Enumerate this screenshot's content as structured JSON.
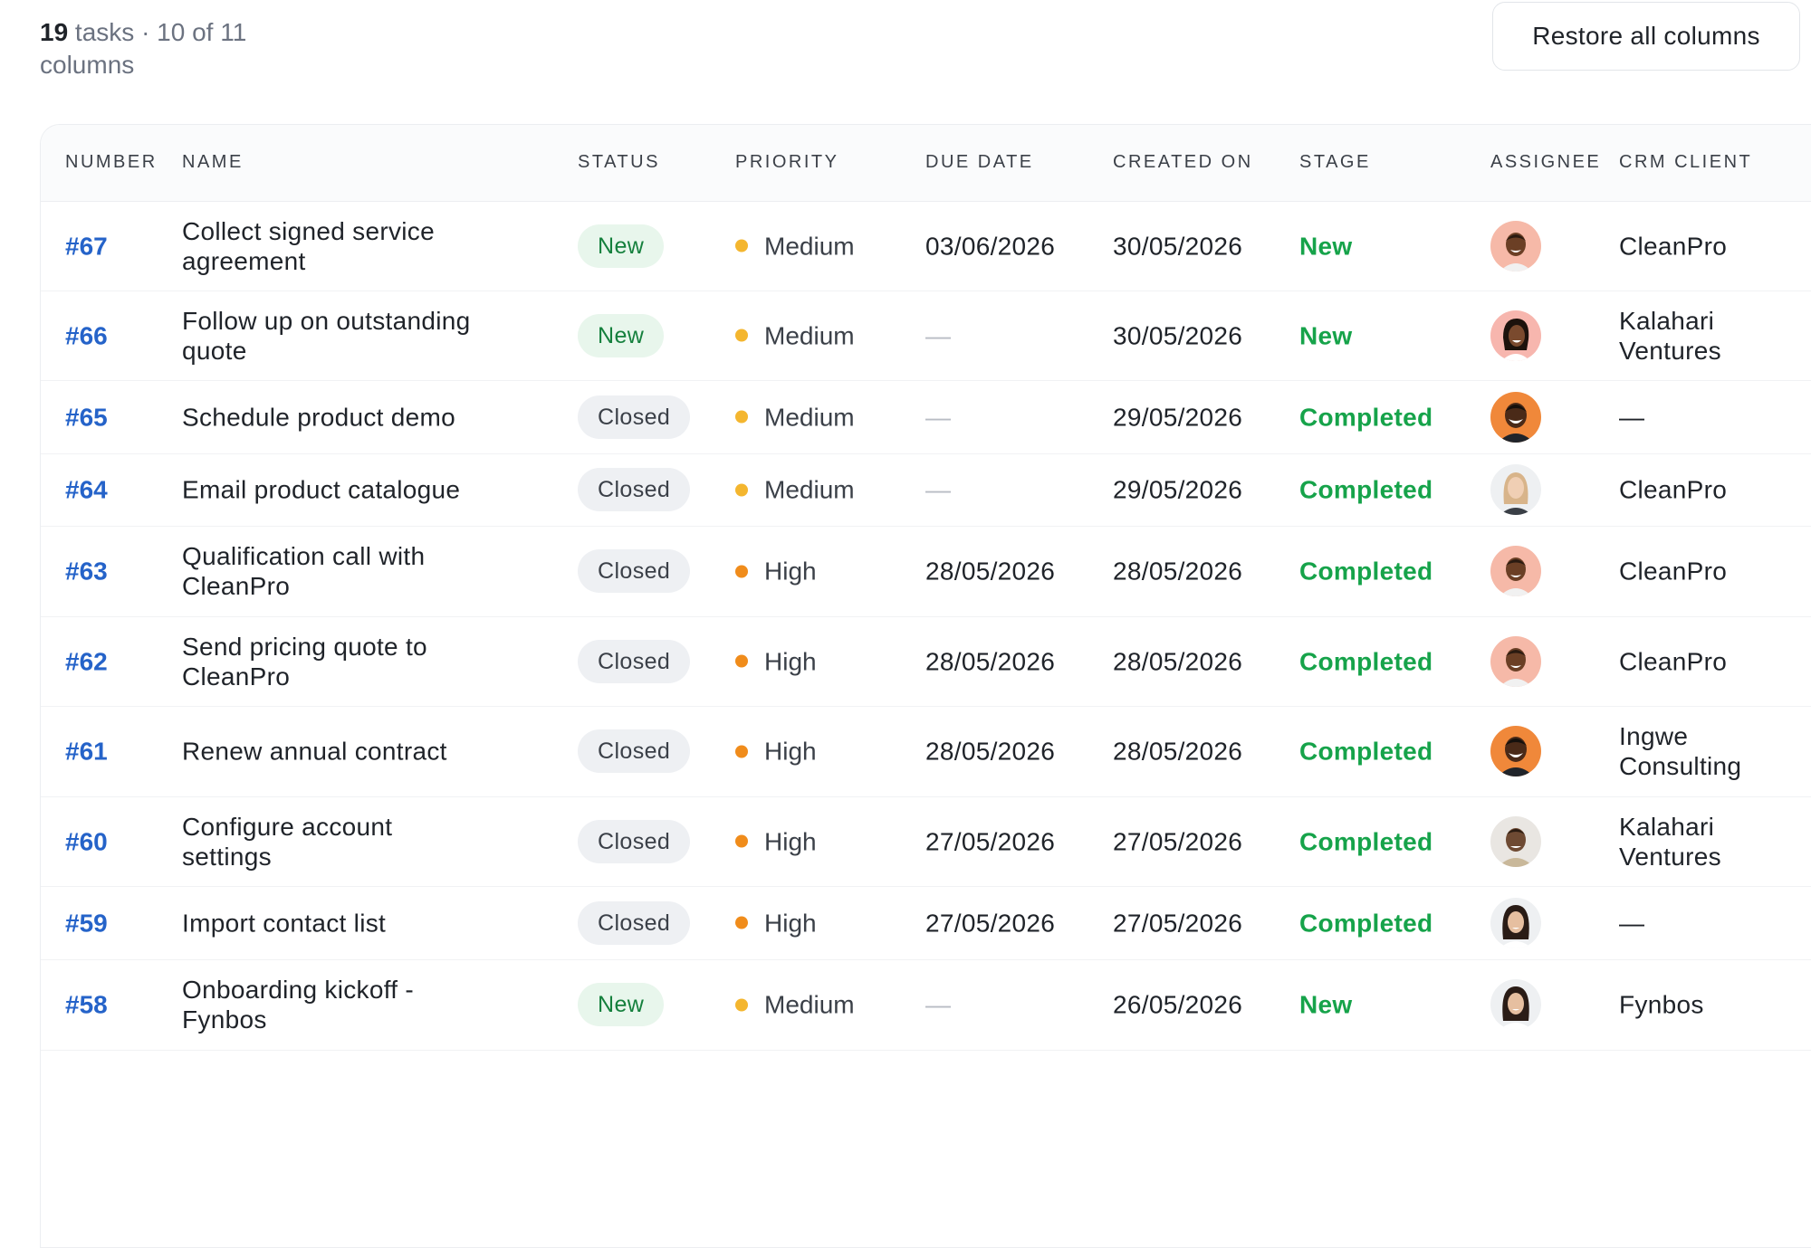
{
  "summary": {
    "count": "19",
    "text": " tasks · 10 of 11 columns"
  },
  "restore_button": "Restore all columns",
  "columns": [
    "NUMBER",
    "NAME",
    "STATUS",
    "PRIORITY",
    "DUE DATE",
    "CREATED ON",
    "STAGE",
    "ASSIGNEE",
    "CRM CLIENT"
  ],
  "colors": {
    "accent": "#2563c9",
    "stage_green": "#16a34a",
    "priority_medium": "#f4b62f",
    "priority_high": "#f08c1b"
  },
  "rows": [
    {
      "number": "#67",
      "name": "Collect signed service agreement",
      "status": "New",
      "priority": "Medium",
      "due": "03/06/2026",
      "created": "30/05/2026",
      "stage": "New",
      "assignee": "avatar-1-icon",
      "client": "CleanPro"
    },
    {
      "number": "#66",
      "name": "Follow up on outstanding quote",
      "status": "New",
      "priority": "Medium",
      "due": "—",
      "created": "30/05/2026",
      "stage": "New",
      "assignee": "avatar-2-icon",
      "client": "Kalahari Ventures"
    },
    {
      "number": "#65",
      "name": "Schedule product demo",
      "status": "Closed",
      "priority": "Medium",
      "due": "—",
      "created": "29/05/2026",
      "stage": "Completed",
      "assignee": "avatar-3-icon",
      "client": "—"
    },
    {
      "number": "#64",
      "name": "Email product catalogue",
      "status": "Closed",
      "priority": "Medium",
      "due": "—",
      "created": "29/05/2026",
      "stage": "Completed",
      "assignee": "avatar-4-icon",
      "client": "CleanPro"
    },
    {
      "number": "#63",
      "name": "Qualification call with CleanPro",
      "status": "Closed",
      "priority": "High",
      "due": "28/05/2026",
      "created": "28/05/2026",
      "stage": "Completed",
      "assignee": "avatar-1-icon",
      "client": "CleanPro"
    },
    {
      "number": "#62",
      "name": "Send pricing quote to CleanPro",
      "status": "Closed",
      "priority": "High",
      "due": "28/05/2026",
      "created": "28/05/2026",
      "stage": "Completed",
      "assignee": "avatar-1-icon",
      "client": "CleanPro"
    },
    {
      "number": "#61",
      "name": "Renew annual contract",
      "status": "Closed",
      "priority": "High",
      "due": "28/05/2026",
      "created": "28/05/2026",
      "stage": "Completed",
      "assignee": "avatar-3-icon",
      "client": "Ingwe Consulting"
    },
    {
      "number": "#60",
      "name": "Configure account settings",
      "status": "Closed",
      "priority": "High",
      "due": "27/05/2026",
      "created": "27/05/2026",
      "stage": "Completed",
      "assignee": "avatar-5-icon",
      "client": "Kalahari Ventures"
    },
    {
      "number": "#59",
      "name": "Import contact list",
      "status": "Closed",
      "priority": "High",
      "due": "27/05/2026",
      "created": "27/05/2026",
      "stage": "Completed",
      "assignee": "avatar-6-icon",
      "client": "—"
    },
    {
      "number": "#58",
      "name": "Onboarding kickoff - Fynbos",
      "status": "New",
      "priority": "Medium",
      "due": "—",
      "created": "26/05/2026",
      "stage": "New",
      "assignee": "avatar-6-icon",
      "client": "Fynbos"
    }
  ]
}
